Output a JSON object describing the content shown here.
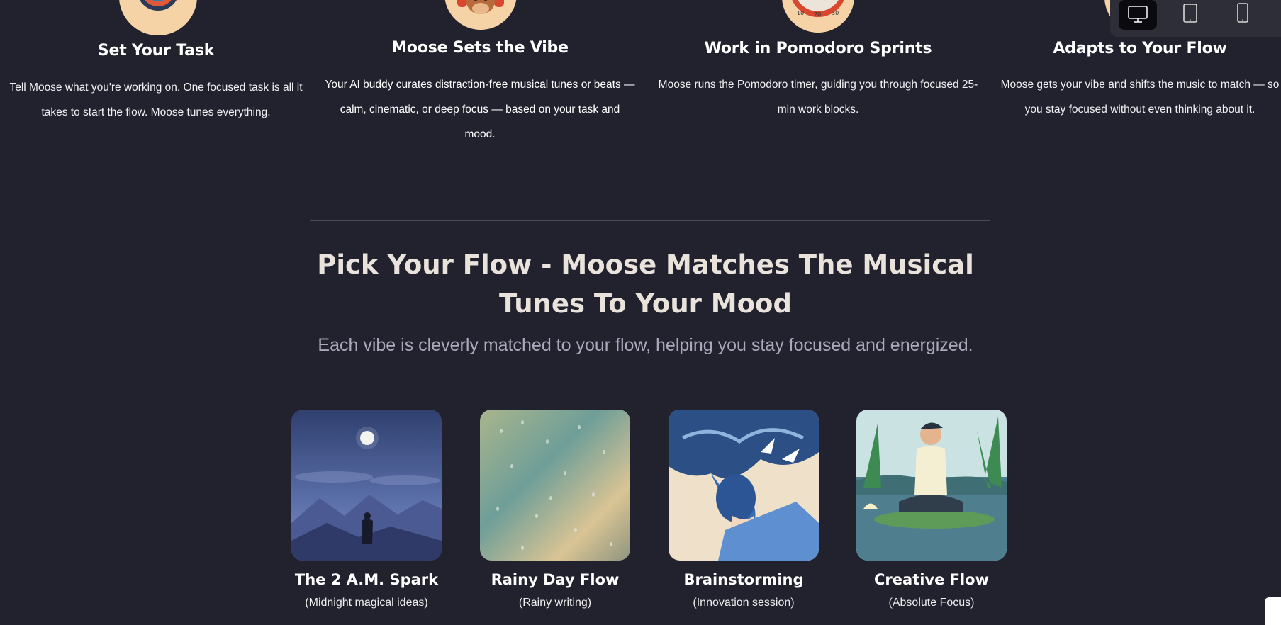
{
  "steps": [
    {
      "title": "Set Your Task",
      "description": "Tell Moose what you're working on. One focused task is all it takes to start the flow. Moose tunes everything.",
      "icon": "target-icon"
    },
    {
      "title": "Moose Sets the Vibe",
      "description": "Your AI buddy curates distraction-free musical tunes or beats — calm, cinematic, or deep focus — based on your task and mood.",
      "icon": "moose-headphones-icon"
    },
    {
      "title": "Work in Pomodoro Sprints",
      "description": "Moose runs the Pomodoro timer, guiding you through focused 25-min work blocks.",
      "icon": "pomodoro-timer-icon",
      "timer_labels": [
        "10",
        "20",
        "30"
      ]
    },
    {
      "title": "Adapts to Your Flow",
      "description": "Moose gets your vibe and shifts the music to match — so you stay focused without even thinking about it.",
      "icon": "moose-adapt-icon"
    }
  ],
  "device_toolbar": {
    "options": [
      "desktop",
      "tablet",
      "mobile"
    ],
    "selected": "desktop"
  },
  "flow_section": {
    "title": "Pick Your Flow - Moose Matches The Musical Tunes To Your Mood",
    "subtitle": "Each vibe is cleverly matched to your flow, helping you stay focused and energized."
  },
  "flows": [
    {
      "title": "The 2 A.M. Spark",
      "subtitle": "(Midnight magical ideas)",
      "image": "night-mountain-moon"
    },
    {
      "title": "Rainy Day Flow",
      "subtitle": "(Rainy writing)",
      "image": "raindrops-window"
    },
    {
      "title": "Brainstorming",
      "subtitle": "(Innovation session)",
      "image": "woman-birds-waves"
    },
    {
      "title": "Creative Flow",
      "subtitle": "(Absolute Focus)",
      "image": "meditating-man-lily-pad"
    }
  ],
  "colors": {
    "background": "#22222f",
    "icon_circle": "#f6d3a7",
    "heading": "#e9e3dc",
    "subtitle": "#a9aabb"
  }
}
